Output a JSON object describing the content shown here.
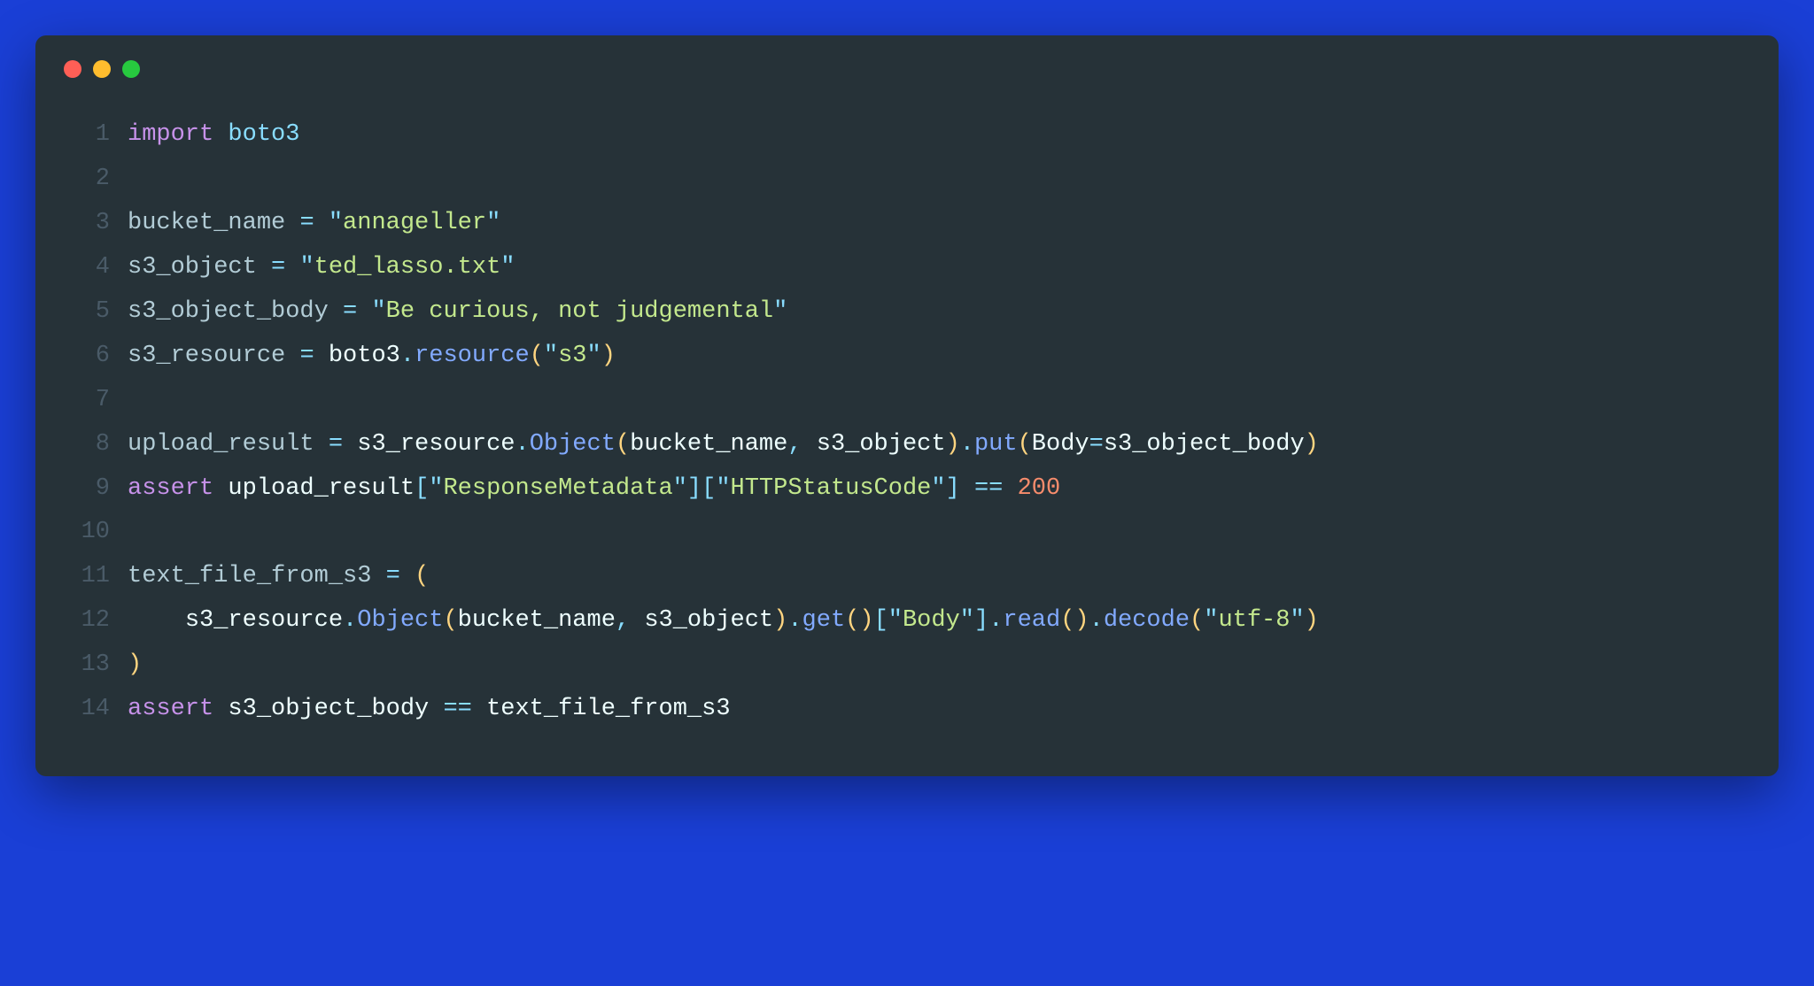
{
  "window": {
    "traffic_lights": [
      "close",
      "minimize",
      "maximize"
    ]
  },
  "code": {
    "line_count": 14,
    "lines": [
      {
        "num": "1",
        "tokens": [
          [
            "keyword",
            "import"
          ],
          [
            "default",
            " "
          ],
          [
            "module",
            "boto3"
          ]
        ]
      },
      {
        "num": "2",
        "tokens": []
      },
      {
        "num": "3",
        "tokens": [
          [
            "varlight",
            "bucket_name"
          ],
          [
            "default",
            " "
          ],
          [
            "operator",
            "="
          ],
          [
            "default",
            " "
          ],
          [
            "punct",
            "\""
          ],
          [
            "string",
            "annageller"
          ],
          [
            "punct",
            "\""
          ]
        ]
      },
      {
        "num": "4",
        "tokens": [
          [
            "varlight",
            "s3_object"
          ],
          [
            "default",
            " "
          ],
          [
            "operator",
            "="
          ],
          [
            "default",
            " "
          ],
          [
            "punct",
            "\""
          ],
          [
            "string",
            "ted_lasso.txt"
          ],
          [
            "punct",
            "\""
          ]
        ]
      },
      {
        "num": "5",
        "tokens": [
          [
            "varlight",
            "s3_object_body"
          ],
          [
            "default",
            " "
          ],
          [
            "operator",
            "="
          ],
          [
            "default",
            " "
          ],
          [
            "punct",
            "\""
          ],
          [
            "string",
            "Be curious, not judgemental"
          ],
          [
            "punct",
            "\""
          ]
        ]
      },
      {
        "num": "6",
        "tokens": [
          [
            "varlight",
            "s3_resource"
          ],
          [
            "default",
            " "
          ],
          [
            "operator",
            "="
          ],
          [
            "default",
            " "
          ],
          [
            "variable",
            "boto3"
          ],
          [
            "punct",
            "."
          ],
          [
            "function",
            "resource"
          ],
          [
            "paren",
            "("
          ],
          [
            "punct",
            "\""
          ],
          [
            "string",
            "s3"
          ],
          [
            "punct",
            "\""
          ],
          [
            "paren",
            ")"
          ]
        ]
      },
      {
        "num": "7",
        "tokens": []
      },
      {
        "num": "8",
        "tokens": [
          [
            "varlight",
            "upload_result"
          ],
          [
            "default",
            " "
          ],
          [
            "operator",
            "="
          ],
          [
            "default",
            " "
          ],
          [
            "variable",
            "s3_resource"
          ],
          [
            "punct",
            "."
          ],
          [
            "function",
            "Object"
          ],
          [
            "paren",
            "("
          ],
          [
            "variable",
            "bucket_name"
          ],
          [
            "punct",
            ","
          ],
          [
            "default",
            " "
          ],
          [
            "variable",
            "s3_object"
          ],
          [
            "paren",
            ")"
          ],
          [
            "punct",
            "."
          ],
          [
            "function",
            "put"
          ],
          [
            "paren",
            "("
          ],
          [
            "variable",
            "Body"
          ],
          [
            "operator",
            "="
          ],
          [
            "variable",
            "s3_object_body"
          ],
          [
            "paren",
            ")"
          ]
        ]
      },
      {
        "num": "9",
        "tokens": [
          [
            "keyword",
            "assert"
          ],
          [
            "default",
            " "
          ],
          [
            "variable",
            "upload_result"
          ],
          [
            "punct",
            "["
          ],
          [
            "punct",
            "\""
          ],
          [
            "string",
            "ResponseMetadata"
          ],
          [
            "punct",
            "\""
          ],
          [
            "punct",
            "]"
          ],
          [
            "punct",
            "["
          ],
          [
            "punct",
            "\""
          ],
          [
            "string",
            "HTTPStatusCode"
          ],
          [
            "punct",
            "\""
          ],
          [
            "punct",
            "]"
          ],
          [
            "default",
            " "
          ],
          [
            "operator",
            "=="
          ],
          [
            "default",
            " "
          ],
          [
            "number",
            "200"
          ]
        ]
      },
      {
        "num": "10",
        "tokens": []
      },
      {
        "num": "11",
        "tokens": [
          [
            "varlight",
            "text_file_from_s3"
          ],
          [
            "default",
            " "
          ],
          [
            "operator",
            "="
          ],
          [
            "default",
            " "
          ],
          [
            "paren",
            "("
          ]
        ]
      },
      {
        "num": "12",
        "tokens": [
          [
            "default",
            "    "
          ],
          [
            "variable",
            "s3_resource"
          ],
          [
            "punct",
            "."
          ],
          [
            "function",
            "Object"
          ],
          [
            "paren",
            "("
          ],
          [
            "variable",
            "bucket_name"
          ],
          [
            "punct",
            ","
          ],
          [
            "default",
            " "
          ],
          [
            "variable",
            "s3_object"
          ],
          [
            "paren",
            ")"
          ],
          [
            "punct",
            "."
          ],
          [
            "function",
            "get"
          ],
          [
            "paren",
            "("
          ],
          [
            "paren",
            ")"
          ],
          [
            "punct",
            "["
          ],
          [
            "punct",
            "\""
          ],
          [
            "string",
            "Body"
          ],
          [
            "punct",
            "\""
          ],
          [
            "punct",
            "]"
          ],
          [
            "punct",
            "."
          ],
          [
            "function",
            "read"
          ],
          [
            "paren",
            "("
          ],
          [
            "paren",
            ")"
          ],
          [
            "punct",
            "."
          ],
          [
            "function",
            "decode"
          ],
          [
            "paren",
            "("
          ],
          [
            "punct",
            "\""
          ],
          [
            "string",
            "utf-8"
          ],
          [
            "punct",
            "\""
          ],
          [
            "paren",
            ")"
          ]
        ]
      },
      {
        "num": "13",
        "tokens": [
          [
            "paren",
            ")"
          ]
        ]
      },
      {
        "num": "14",
        "tokens": [
          [
            "keyword",
            "assert"
          ],
          [
            "default",
            " "
          ],
          [
            "variable",
            "s3_object_body"
          ],
          [
            "default",
            " "
          ],
          [
            "operator",
            "=="
          ],
          [
            "default",
            " "
          ],
          [
            "variable",
            "text_file_from_s3"
          ]
        ]
      }
    ]
  }
}
